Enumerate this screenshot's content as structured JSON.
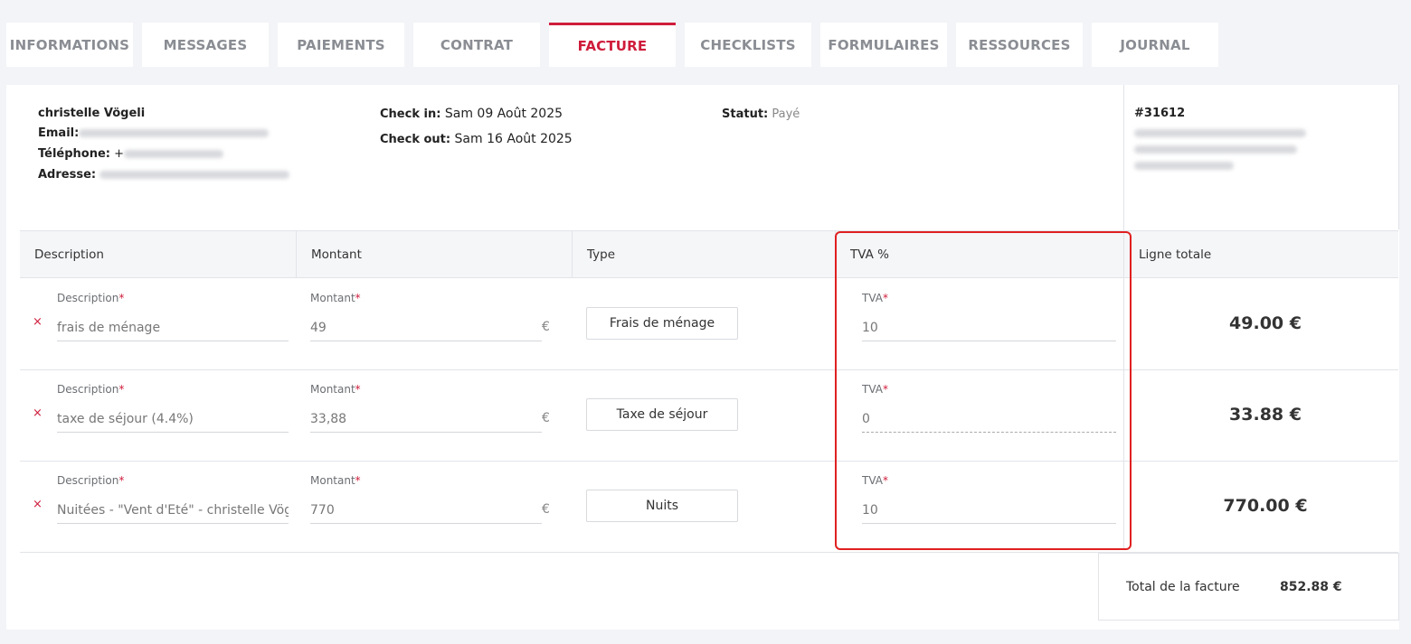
{
  "tabs": [
    {
      "label": "INFORMATIONS",
      "active": false
    },
    {
      "label": "MESSAGES",
      "active": false
    },
    {
      "label": "PAIEMENTS",
      "active": false
    },
    {
      "label": "CONTRAT",
      "active": false
    },
    {
      "label": "FACTURE",
      "active": true
    },
    {
      "label": "CHECKLISTS",
      "active": false
    },
    {
      "label": "FORMULAIRES",
      "active": false
    },
    {
      "label": "RESSOURCES",
      "active": false
    },
    {
      "label": "JOURNAL",
      "active": false
    }
  ],
  "guest": {
    "name": "christelle Vögeli",
    "email_label": "Email:",
    "phone_label": "Téléphone:",
    "phone_prefix": "+",
    "address_label": "Adresse:"
  },
  "stay": {
    "checkin_label": "Check in:",
    "checkin_value": "Sam 09 Août 2025",
    "checkout_label": "Check out:",
    "checkout_value": "Sam 16 Août 2025"
  },
  "status": {
    "label": "Statut:",
    "value": "Payé"
  },
  "invoice": {
    "number": "#31612"
  },
  "table": {
    "headers": [
      "Description",
      "Montant",
      "Type",
      "TVA %",
      "Ligne totale"
    ],
    "field_labels": {
      "description": "Description",
      "amount": "Montant",
      "vat": "TVA",
      "required": "*"
    },
    "currency": "€",
    "remove_icon": "×",
    "rows": [
      {
        "description": "frais de ménage",
        "amount": "49",
        "type": "Frais de ménage",
        "vat": "10",
        "total": "49.00 €"
      },
      {
        "description": "taxe de séjour (4.4%)",
        "amount": "33,88",
        "type": "Taxe de séjour",
        "vat": "0",
        "total": "33.88 €"
      },
      {
        "description": "Nuitées - \"Vent d'Eté\" - christelle Vögeli",
        "amount": "770",
        "type": "Nuits",
        "vat": "10",
        "total": "770.00 €"
      }
    ]
  },
  "summary": {
    "label": "Total de la facture",
    "value": "852.88 €"
  },
  "colors": {
    "accent": "#cf1c3b",
    "highlight": "#e02020"
  }
}
